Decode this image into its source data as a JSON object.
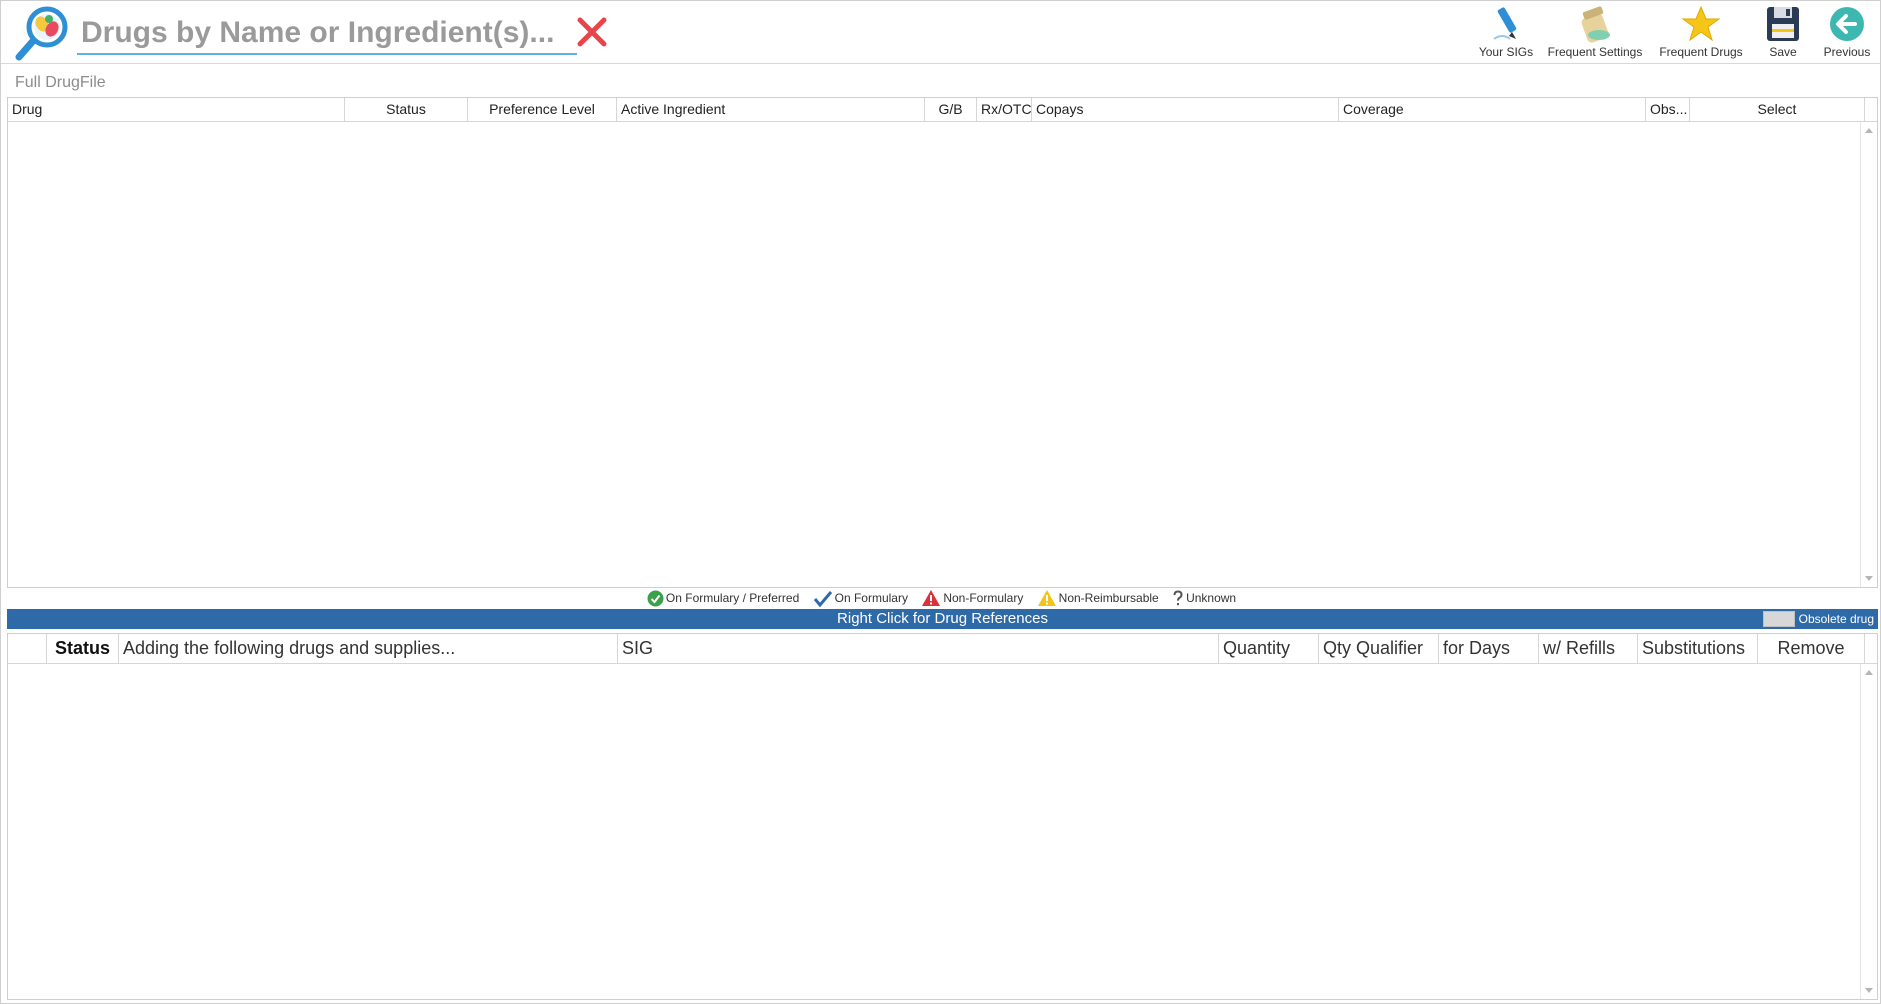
{
  "search": {
    "placeholder": "Drugs by Name or Ingredient(s)..."
  },
  "toolbar": {
    "buttons": [
      {
        "label": "Your SIGs",
        "icon": "pen-icon"
      },
      {
        "label": "Frequent Settings",
        "icon": "pill-bottle-icon"
      },
      {
        "label": "Frequent Drugs",
        "icon": "star-icon"
      },
      {
        "label": "Save",
        "icon": "floppy-disk-icon"
      },
      {
        "label": "Previous",
        "icon": "back-arrow-icon"
      }
    ]
  },
  "section_label": "Full DrugFile",
  "grid1": {
    "columns": [
      "Drug",
      "Status",
      "Preference Level",
      "Active Ingredient",
      "G/B",
      "Rx/OTC",
      "Copays",
      "Coverage",
      "Obs...",
      "Select"
    ],
    "rows": []
  },
  "legend": {
    "items": [
      {
        "label": "On Formulary / Preferred",
        "icon": "green-check-circle-icon"
      },
      {
        "label": "On Formulary",
        "icon": "blue-check-icon"
      },
      {
        "label": "Non-Formulary",
        "icon": "red-warning-icon"
      },
      {
        "label": "Non-Reimbursable",
        "icon": "yellow-warning-icon"
      },
      {
        "label": "Unknown",
        "icon": "question-mark-icon"
      }
    ]
  },
  "refbar": {
    "text": "Right Click for Drug References",
    "obsolete_label": "Obsolete drug"
  },
  "grid2": {
    "columns": [
      "",
      "Status",
      "Adding the following drugs and supplies...",
      "SIG",
      "Quantity",
      "Qty Qualifier",
      "for Days",
      "w/ Refills",
      "Substitutions",
      "Remove"
    ],
    "rows": []
  },
  "colors": {
    "accent_blue": "#2f6aa8",
    "search_underline": "#5ab4e6",
    "clear_red": "#e8454b",
    "legend_green": "#3aa14a",
    "legend_red": "#d9323a",
    "legend_yellow": "#f0c419"
  }
}
